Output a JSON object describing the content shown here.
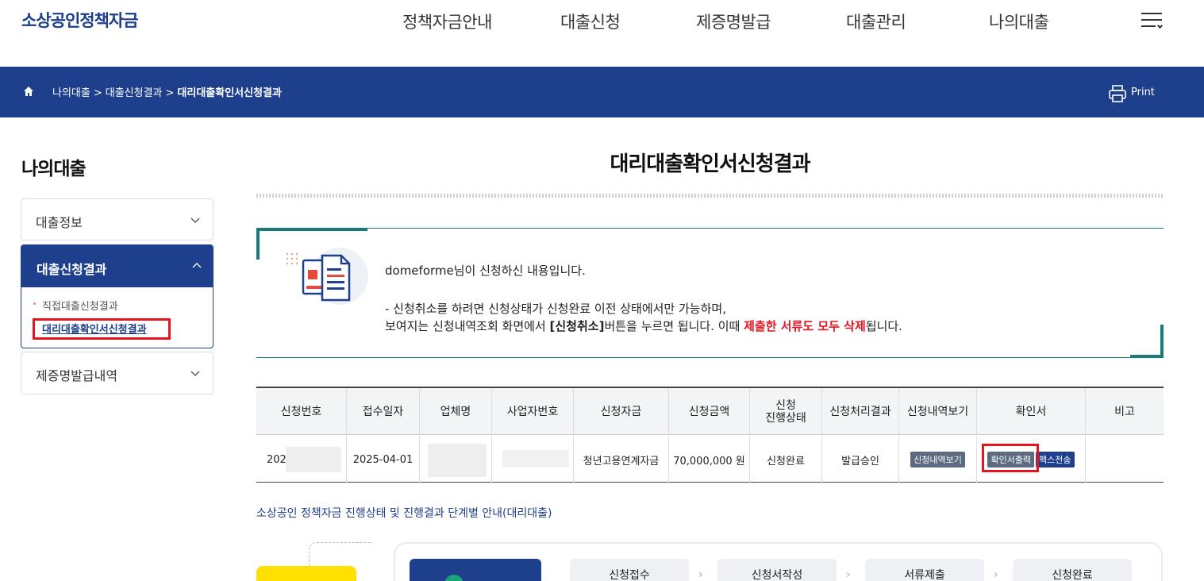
{
  "header": {
    "logo": "소상공인정책자금",
    "nav": [
      "정책자금안내",
      "대출신청",
      "제증명발급",
      "대출관리",
      "나의대출"
    ]
  },
  "breadcrumb": {
    "items": [
      "나의대출",
      "대출신청결과",
      "대리대출확인서신청결과"
    ],
    "separator": ">",
    "print_label": "Print"
  },
  "sidebar": {
    "title": "나의대출",
    "items": [
      {
        "label": "대출정보"
      },
      {
        "label": "대출신청결과",
        "sub": [
          "직접대출신청결과",
          "대리대출확인서신청결과"
        ]
      },
      {
        "label": "제증명발급내역"
      }
    ]
  },
  "main": {
    "title": "대리대출확인서신청결과",
    "notice": {
      "line1": "domeforme님이 신청하신 내용입니다.",
      "line2": "- 신청취소를 하려면 신청상태가 신청완료 이전 상태에서만 가능하며,",
      "line3_a": "보여지는 신청내역조회 화면에서 ",
      "line3_b": "[신청취소]",
      "line3_c": "버튼을 누르면 됩니다. 이때 ",
      "line3_d": "제출한 서류도 모두 삭제",
      "line3_e": "됩니다."
    },
    "table": {
      "headers": [
        "신청번호",
        "접수일자",
        "업체명",
        "사업자번호",
        "신청자금",
        "신청금액",
        "신청\n진행상태",
        "신청처리결과",
        "신청내역보기",
        "확인서",
        "비고"
      ],
      "row": {
        "app_no": "2025",
        "date": "2025-04-01",
        "company": "",
        "biz_no": "",
        "fund": "청년고용연계자금",
        "amount": "70,000,000 원",
        "status": "신청완료",
        "result": "발급승인",
        "view_btn": "신청내역보기",
        "print_btn": "확인서출력",
        "fax_btn": "팩스전송",
        "note": ""
      }
    },
    "guide": {
      "title": "소상공인 정책자금 진행상태 및 진행결과 단계별 안내(대리대출)",
      "steps": [
        "신청접수",
        "신청서작성",
        "서류제출",
        "신청완료"
      ]
    }
  },
  "colors": {
    "navy": "#1e3f8b",
    "teal": "#1a7a7a",
    "highlight_red": "#e6141e",
    "yellow": "#ffe000"
  }
}
